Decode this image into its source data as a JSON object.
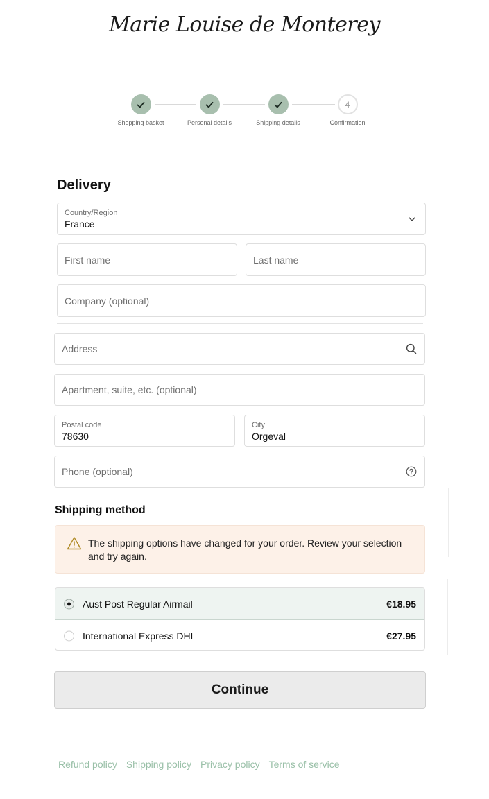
{
  "brand": {
    "logo_text": "Marie Louise de Monterey"
  },
  "steps": [
    {
      "label": "Shopping basket",
      "state": "done"
    },
    {
      "label": "Personal details",
      "state": "done"
    },
    {
      "label": "Shipping details",
      "state": "done"
    },
    {
      "label": "Confirmation",
      "state": "pending",
      "number": "4"
    }
  ],
  "delivery": {
    "title": "Delivery",
    "country": {
      "label": "Country/Region",
      "value": "France"
    },
    "first_name": {
      "placeholder": "First name"
    },
    "last_name": {
      "placeholder": "Last name"
    },
    "company": {
      "placeholder": "Company (optional)"
    },
    "address": {
      "placeholder": "Address"
    },
    "apartment": {
      "placeholder": "Apartment, suite, etc. (optional)"
    },
    "postal_code": {
      "label": "Postal code",
      "value": "78630"
    },
    "city": {
      "label": "City",
      "value": "Orgeval"
    },
    "phone": {
      "placeholder": "Phone (optional)"
    }
  },
  "shipping": {
    "title": "Shipping method",
    "warning": "The shipping options have changed for your order. Review your selection and try again.",
    "options": [
      {
        "name": "Aust Post Regular Airmail",
        "price": "€18.95",
        "selected": true
      },
      {
        "name": "International Express DHL",
        "price": "€27.95",
        "selected": false
      }
    ]
  },
  "continue_label": "Continue",
  "footer": {
    "links": [
      "Refund policy",
      "Shipping policy",
      "Privacy policy",
      "Terms of service"
    ]
  },
  "colors": {
    "step_done": "#a8bfae",
    "warning_bg": "#fdf1e8",
    "selected_bg": "#eef4f1",
    "footer_link": "#9ac0a8"
  }
}
